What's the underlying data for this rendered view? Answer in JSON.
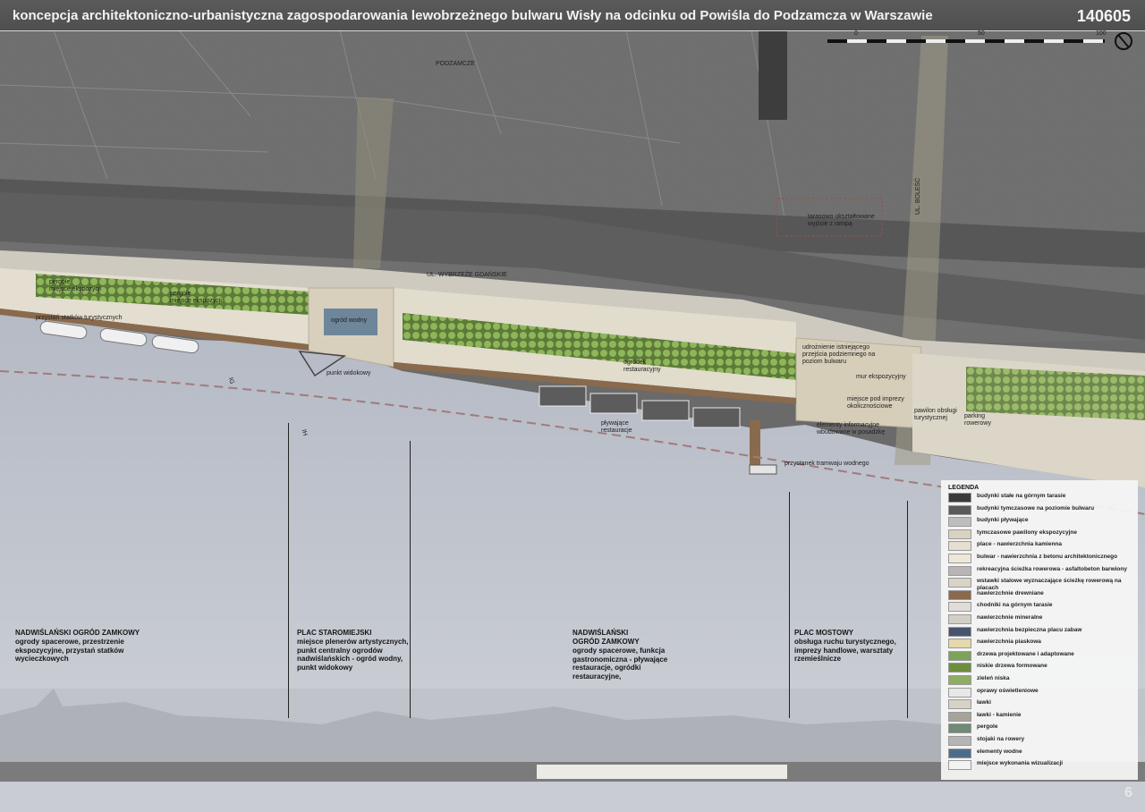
{
  "header": {
    "title": "koncepcja architektoniczno-urbanistyczna zagospodarowania lewobrzeżnego bulwaru Wisły na odcinku od Powiśla do Podzamcza w Warszawie",
    "plate_number": "140605"
  },
  "scale": {
    "labels": [
      "0",
      "50",
      "100"
    ]
  },
  "map_labels": {
    "podzamcze": "PODZAMCZE",
    "wybrzeze": "UL. WYBRZEŻE GDAŃSKIE",
    "bolesc": "UL. BOLEŚĆ",
    "tarasowo": "tarasowo ukształtowane wyjście z rampą",
    "pergole1": "pergole",
    "miejsce_eksp": "miejsce ekspozycji",
    "pergole2": "pergole",
    "miejsce_eksp2": "miejsce ekspozycji",
    "przystan": "przystań statków turystycznych",
    "ogrod_wodny": "ogród wodny",
    "punkt": "punkt widokowy",
    "ogrodek": "ogródek restauracyjny",
    "plywajace": "pływające restauracje",
    "udroznienie": "udrożnienie istniejącego przejścia podziemnego na poziom bulwaru",
    "mur": "mur ekspozycyjny",
    "imprezy": "miejsce pod imprezy okolicznościowe",
    "elementy": "elementy informacyjne wbudowane w posadzkę",
    "pawilon": "pawilon obsługi turystycznej",
    "parking": "parking rowerowy",
    "tramwaj": "przystanek tramwaju wodnego"
  },
  "section_marks": [
    "IG",
    "IH"
  ],
  "zones": [
    {
      "title": "NADWIŚLAŃSKI OGRÓD ZAMKOWY",
      "desc": "ogrody spacerowe, przestrzenie ekspozycyjne, przystań statków wycieczkowych"
    },
    {
      "title": "PLAC STAROMIEJSKI",
      "desc": "miejsce plenerów artystycznych, punkt centralny ogrodów nadwiślańskich - ogród wodny, punkt widokowy"
    },
    {
      "title": "NADWIŚLAŃSKI OGRÓD ZAMKOWY",
      "desc": "ogrody spacerowe, funkcja gastronomiczna - pływające restauracje, ogródki restauracyjne,"
    },
    {
      "title": "PLAC MOSTOWY",
      "desc": "obsługa ruchu turystycznego, imprezy handlowe, warsztaty rzemieślnicze"
    }
  ],
  "legend": {
    "title": "LEGENDA",
    "items": [
      {
        "label": "budynki stałe na górnym tarasie",
        "color": "#3a3a3a"
      },
      {
        "label": "budynki tymczasowe na poziomie bulwaru",
        "color": "#5a5a5a"
      },
      {
        "label": "budynki pływające",
        "color": "#bdbdbd"
      },
      {
        "label": "tymczasowe pawilony ekspozycyjne",
        "color": "#d9d2c0"
      },
      {
        "label": "place - nawierzchnia kamienna",
        "color": "#e6dfcf"
      },
      {
        "label": "bulwar - nawierzchnia z betonu architektonicznego",
        "color": "#ece7d9"
      },
      {
        "label": "rekreacyjna ścieżka rowerowa - asfaltobeton barwiony",
        "color": "#bbb4b6"
      },
      {
        "label": "wstawki stalowe wyznaczające ścieżkę rowerową na placach",
        "color": "#d8d4c6"
      },
      {
        "label": "nawierzchnie drewniane",
        "color": "#8a6a4c"
      },
      {
        "label": "chodniki na górnym tarasie",
        "color": "#e0ddd6"
      },
      {
        "label": "nawierzchnie mineralne",
        "color": "#d3cfc4"
      },
      {
        "label": "nawierzchnia bezpieczna placu zabaw",
        "color": "#48546e"
      },
      {
        "label": "nawierzchnia piaskowa",
        "color": "#e4d8ae"
      },
      {
        "label": "drzewa projektowane i adaptowane",
        "color": "#7da35a"
      },
      {
        "label": "niskie drzewa formowane",
        "color": "#6c8e3e"
      },
      {
        "label": "zieleń niska",
        "color": "#8eae63"
      },
      {
        "label": "oprawy oświetleniowe",
        "color": "#e8e8e8"
      },
      {
        "label": "ławki",
        "color": "#d7d2c4"
      },
      {
        "label": "ławki - kamienie",
        "color": "#a8a39a"
      },
      {
        "label": "pergole",
        "color": "#6f8a76"
      },
      {
        "label": "stojaki na rowery",
        "color": "#b5b5b5"
      },
      {
        "label": "elementy wodne",
        "color": "#4c6d8a"
      },
      {
        "label": "miejsce wykonania wizualizacji",
        "color": "#f2f2f2"
      }
    ]
  },
  "page_number": "6"
}
